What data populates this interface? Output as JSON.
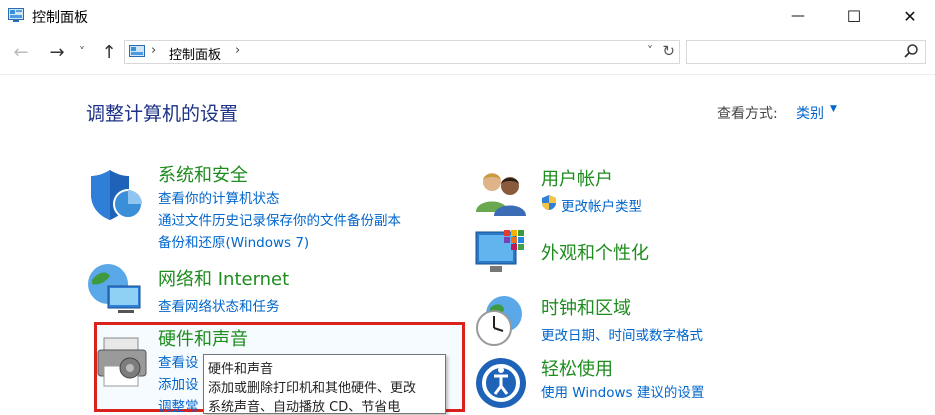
{
  "window": {
    "title": "控制面板",
    "minimize": "—",
    "maximize": "☐",
    "close": "✕"
  },
  "nav": {
    "back": "←",
    "forward": "→",
    "recent": "˅",
    "up": "↑",
    "breadcrumb": [
      "控制面板"
    ],
    "sep": "›",
    "refresh": "↻",
    "dropdown": "˅",
    "search_placeholder": ""
  },
  "main": {
    "heading": "调整计算机的设置",
    "view_by_label": "查看方式:",
    "view_by_value": "类别",
    "view_by_arrow": "▼"
  },
  "categories": {
    "system_security": {
      "title": "系统和安全",
      "links": [
        "查看你的计算机状态",
        "通过文件历史记录保存你的文件备份副本",
        "备份和还原(Windows 7)"
      ]
    },
    "network": {
      "title": "网络和 Internet",
      "links": [
        "查看网络状态和任务"
      ]
    },
    "hardware": {
      "title": "硬件和声音",
      "links": [
        "查看设",
        "添加设",
        "调整常"
      ]
    },
    "user_accounts": {
      "title": "用户帐户",
      "links": [
        "更改帐户类型"
      ]
    },
    "appearance": {
      "title": "外观和个性化"
    },
    "clock_region": {
      "title": "时钟和区域",
      "links": [
        "更改日期、时间或数字格式"
      ]
    },
    "ease": {
      "title": "轻松使用",
      "links": [
        "使用 Windows 建议的设置"
      ]
    }
  },
  "tooltip": {
    "lines": [
      "硬件和声音",
      "添加或删除打印机和其他硬件、更改",
      "系统声音、自动播放 CD、节省电"
    ]
  },
  "colors": {
    "heading": "#1e3287",
    "category": "#1e8c1e",
    "link": "#0066cc",
    "highlight_border": "#d9221c"
  }
}
